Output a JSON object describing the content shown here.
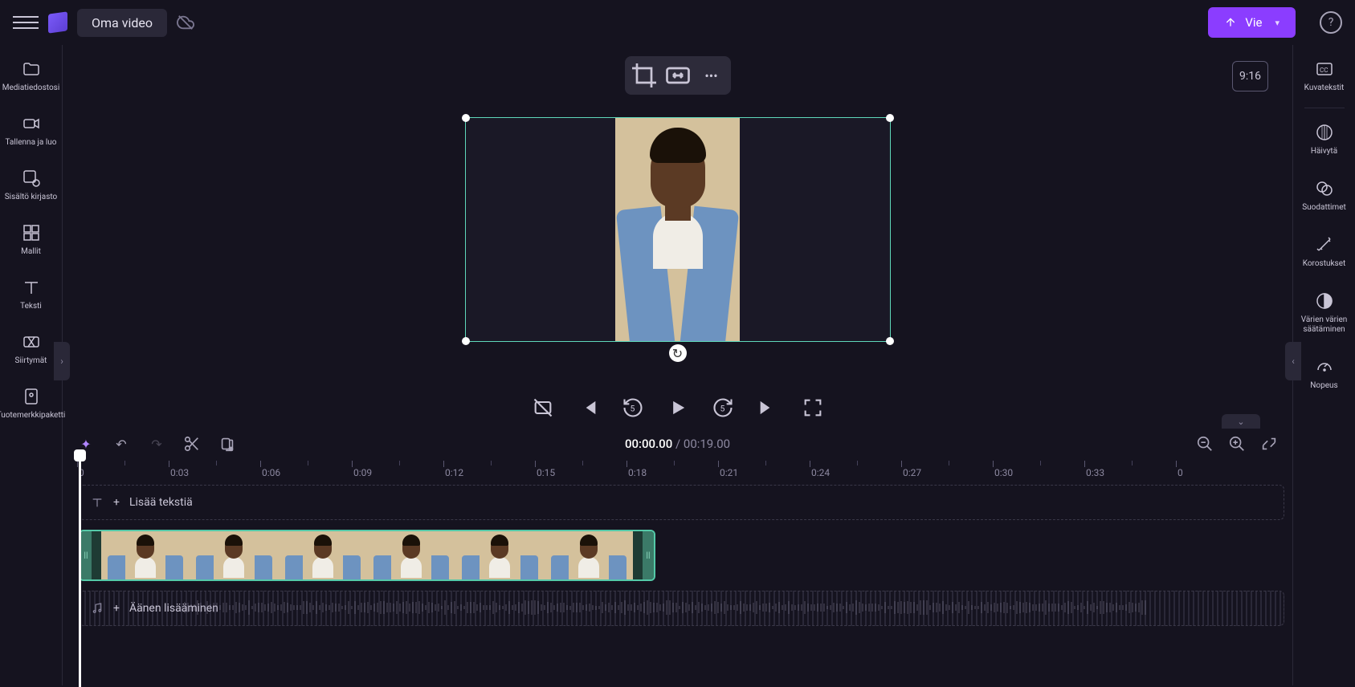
{
  "header": {
    "project_title": "Oma video",
    "export_label": "Vie"
  },
  "left_rail": {
    "media": "Mediatiedostosi",
    "record": "Tallenna ja luo",
    "library": "Sisältö kirjasto",
    "templates": "Mallit",
    "text": "Teksti",
    "transitions": "Siirtymät",
    "brand": "Tuotemerkkipaketti"
  },
  "right_rail": {
    "captions": "Kuvatekstit",
    "fade": "Häivytä",
    "filters": "Suodattimet",
    "highlights": "Korostukset",
    "colors": "Värien värien säätäminen",
    "speed": "Nopeus"
  },
  "preview": {
    "aspect_ratio": "9:16"
  },
  "timeline": {
    "current_time": "00:00.00",
    "total_time": "00:19.00",
    "ruler": [
      "0",
      "0:03",
      "0:06",
      "0:09",
      "0:12",
      "0:15",
      "0:18",
      "0:21",
      "0:24",
      "0:27",
      "0:30",
      "0:33",
      "0"
    ],
    "add_text": "Lisää tekstiä",
    "add_audio": "Äänen lisääminen"
  }
}
